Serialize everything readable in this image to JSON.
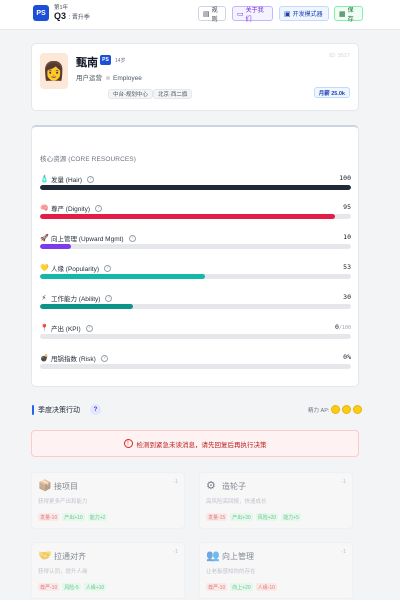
{
  "header": {
    "logo": "PS",
    "year": "第1年",
    "quarter": "Q3",
    "stage": "晋升季",
    "buttons": {
      "rules": "规则",
      "about": "关于我们",
      "dev_mode": "开发模式器",
      "save": "保存"
    }
  },
  "profile": {
    "avatar_icon": "woman-face-icon",
    "name": "甄南",
    "badge": "PS",
    "level": "14岁",
    "role": "用户运营",
    "role_en": "Employee",
    "tags": [
      "中台-规划中心",
      "北京·西二旗"
    ],
    "id": "ID: 9527",
    "salary": "月薪 25.0k"
  },
  "resources": {
    "title": "核心资源 (CORE RESOURCES)",
    "items": [
      {
        "icon": "hair-icon",
        "label": "发量 (Hair)",
        "value": "100",
        "max": "",
        "percent": 100,
        "color": "#1f2937"
      },
      {
        "icon": "brain-icon",
        "label": "尊严 (Dignity)",
        "value": "95",
        "max": "",
        "percent": 95,
        "color": "#e11d48"
      },
      {
        "icon": "rocket-icon",
        "label": "向上管理 (Upward Mgmt)",
        "value": "10",
        "max": "",
        "percent": 10,
        "color": "#7c3aed"
      },
      {
        "icon": "heart-icon",
        "label": "人缘 (Popularity)",
        "value": "53",
        "max": "",
        "percent": 53,
        "color": "#14b8a6"
      },
      {
        "icon": "lightning-icon",
        "label": "工作能力 (Ability)",
        "value": "30",
        "max": "",
        "percent": 30,
        "color": "#0d9488"
      },
      {
        "icon": "pin-icon",
        "label": "产出 (KPI)",
        "value": "0",
        "max": "/100",
        "percent": 0,
        "color": "#2563eb"
      },
      {
        "icon": "bomb-icon",
        "label": "甩锅指数 (Risk)",
        "value": "0%",
        "max": "",
        "percent": 0,
        "color": "#111827"
      }
    ]
  },
  "actions": {
    "title": "季度决策行动",
    "ap_label": "精力 AP:",
    "alert": "检测到紧急未读消息，请先回复后再执行决策",
    "cards": [
      {
        "icon": "box-icon",
        "name": "接项目",
        "num": "-1",
        "desc": "获得更多产出和能力",
        "effects": [
          {
            "text": "发量-10",
            "type": "neg"
          },
          {
            "text": "产出+10",
            "type": "pos"
          },
          {
            "text": "能力+2",
            "type": "pos"
          }
        ]
      },
      {
        "icon": "gear-icon",
        "name": "造轮子",
        "num": "-1",
        "desc": "高风险高回报，快速成长",
        "effects": [
          {
            "text": "发量-15",
            "type": "neg"
          },
          {
            "text": "产出+30",
            "type": "pos"
          },
          {
            "text": "风险+20",
            "type": "pos"
          },
          {
            "text": "能力+5",
            "type": "pos"
          }
        ]
      },
      {
        "icon": "handshake-icon",
        "name": "拉通对齐",
        "num": "-1",
        "desc": "获得认同，提升人缘",
        "effects": [
          {
            "text": "尊严-10",
            "type": "neg"
          },
          {
            "text": "风险-5",
            "type": "pos"
          },
          {
            "text": "人缘+10",
            "type": "pos"
          }
        ]
      },
      {
        "icon": "people-icon",
        "name": "向上管理",
        "num": "-1",
        "desc": "让老板感知你的存在",
        "effects": [
          {
            "text": "尊严-10",
            "type": "neg"
          },
          {
            "text": "向上+20",
            "type": "pos"
          },
          {
            "text": "人缘-10",
            "type": "neg"
          }
        ]
      }
    ]
  }
}
